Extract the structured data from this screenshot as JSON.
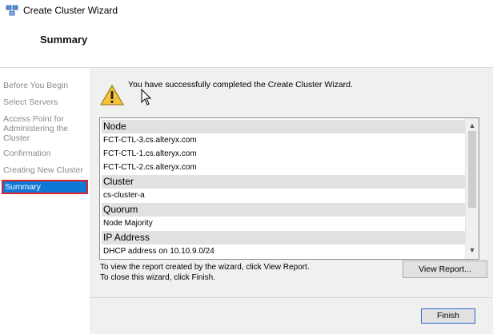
{
  "window": {
    "title": "Create Cluster Wizard"
  },
  "header": {
    "title": "Summary"
  },
  "nav": {
    "items": [
      {
        "label": "Before You Begin"
      },
      {
        "label": "Select Servers"
      },
      {
        "label": "Access Point for Administering the Cluster"
      },
      {
        "label": "Confirmation"
      },
      {
        "label": "Creating New Cluster"
      },
      {
        "label": "Summary"
      }
    ],
    "selected": "Summary",
    "selected_color": "#0f78d7"
  },
  "content": {
    "success_message": "You have successfully completed the Create Cluster Wizard.",
    "icons": {
      "status": "warning-icon",
      "cursor": "mouse-cursor-icon"
    },
    "report": {
      "rows": [
        {
          "type": "group",
          "text": "Node"
        },
        {
          "type": "item",
          "text": "FCT-CTL-3.cs.alteryx.com"
        },
        {
          "type": "item",
          "text": "FCT-CTL-1.cs.alteryx.com"
        },
        {
          "type": "item",
          "text": "FCT-CTL-2.cs.alteryx.com"
        },
        {
          "type": "group",
          "text": "Cluster"
        },
        {
          "type": "item",
          "text": "cs-cluster-a"
        },
        {
          "type": "group",
          "text": "Quorum"
        },
        {
          "type": "item",
          "text": "Node Majority"
        },
        {
          "type": "group",
          "text": "IP Address"
        },
        {
          "type": "item",
          "text": "DHCP address on 10.10.9.0/24"
        }
      ]
    },
    "info_line_1": "To view the report created by the wizard, click View Report.",
    "info_line_2": "To close this wizard, click Finish.",
    "view_report_label": "View Report...",
    "finish_label": "Finish"
  }
}
